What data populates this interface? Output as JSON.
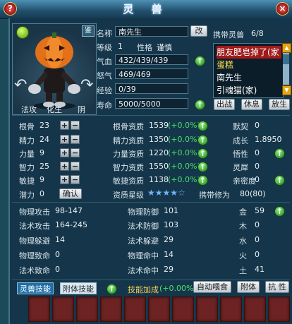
{
  "window": {
    "title": "灵 兽",
    "help_glyph": "?",
    "close_glyph": "×"
  },
  "portrait": {
    "jian_label": "鉴",
    "tabs": [
      "法攻",
      "化生",
      "阴"
    ]
  },
  "info": {
    "name_label": "名称",
    "name_value": "南先生",
    "rename_label": "改",
    "level_label": "等级",
    "level_value": "1",
    "nature_label": "性格",
    "nature_value": "谨慎",
    "hp_label": "气血",
    "hp_value": "432/439/439",
    "anger_label": "怒气",
    "anger_value": "469/469",
    "exp_label": "经验",
    "exp_value": "0/39",
    "life_label": "寿命",
    "life_value": "5000/5000"
  },
  "carry": {
    "label": "携带灵兽",
    "count": "6/8",
    "pets": [
      "朋友肥皂掉了(家",
      "蛋糕",
      "南先生",
      "引魂猫(家)"
    ],
    "buttons": {
      "battle": "出战",
      "rest": "休息",
      "release": "放生"
    }
  },
  "stats": [
    {
      "name": "根骨",
      "value": "23",
      "apt_label": "根骨资质",
      "apt_value": "1539",
      "apt_bonus": "(+0.0%)",
      "right_label": "默契",
      "right_value": "0"
    },
    {
      "name": "精力",
      "value": "24",
      "apt_label": "精力资质",
      "apt_value": "1350",
      "apt_bonus": "(+0.0%)",
      "right_label": "成长",
      "right_value": "1.8950"
    },
    {
      "name": "力量",
      "value": "9",
      "apt_label": "力量资质",
      "apt_value": "1220",
      "apt_bonus": "(+0.0%)",
      "right_label": "悟性",
      "right_value": "0"
    },
    {
      "name": "智力",
      "value": "25",
      "apt_label": "智力资质",
      "apt_value": "1550",
      "apt_bonus": "(+0.0%)",
      "right_label": "灵犀",
      "right_value": "0"
    },
    {
      "name": "敏捷",
      "value": "9",
      "apt_label": "敏捷资质",
      "apt_value": "1138",
      "apt_bonus": "(+0.0%)",
      "right_label": "亲密度",
      "right_value": "0"
    }
  ],
  "potential": {
    "label": "潜力",
    "value": "0",
    "confirm_label": "确认",
    "star_label": "资质星级",
    "stars": "★★★★☆",
    "cultivation_label": "携带修为",
    "cultivation_value": "80(80)"
  },
  "combat": [
    {
      "l1": "物理攻击",
      "v1": "98-147",
      "l2": "物理防御",
      "v2": "101",
      "l3": "金",
      "v3": "59"
    },
    {
      "l1": "法术攻击",
      "v1": "164-245",
      "l2": "法术防御",
      "v2": "103",
      "l3": "木",
      "v3": "0"
    },
    {
      "l1": "物理躲避",
      "v1": "14",
      "l2": "法术躲避",
      "v2": "29",
      "l3": "水",
      "v3": "0"
    },
    {
      "l1": "物理致命",
      "v1": "0",
      "l2": "物理命中",
      "v2": "14",
      "l3": "火",
      "v3": "0"
    },
    {
      "l1": "法术致命",
      "v1": "0",
      "l2": "法术命中",
      "v2": "29",
      "l3": "土",
      "v3": "41"
    }
  ],
  "bottom": {
    "tab_skills": "灵兽技能",
    "tab_attached": "附体技能",
    "skill_bonus_label": "技能加成",
    "skill_bonus_value": "(+0.00%)",
    "auto_feed": "自动喂食",
    "attach": "附体",
    "resist": "抗 性"
  },
  "colors": {
    "accent_green": "#49e06a",
    "gold": "#f4d25a",
    "panel": "#15364a"
  }
}
